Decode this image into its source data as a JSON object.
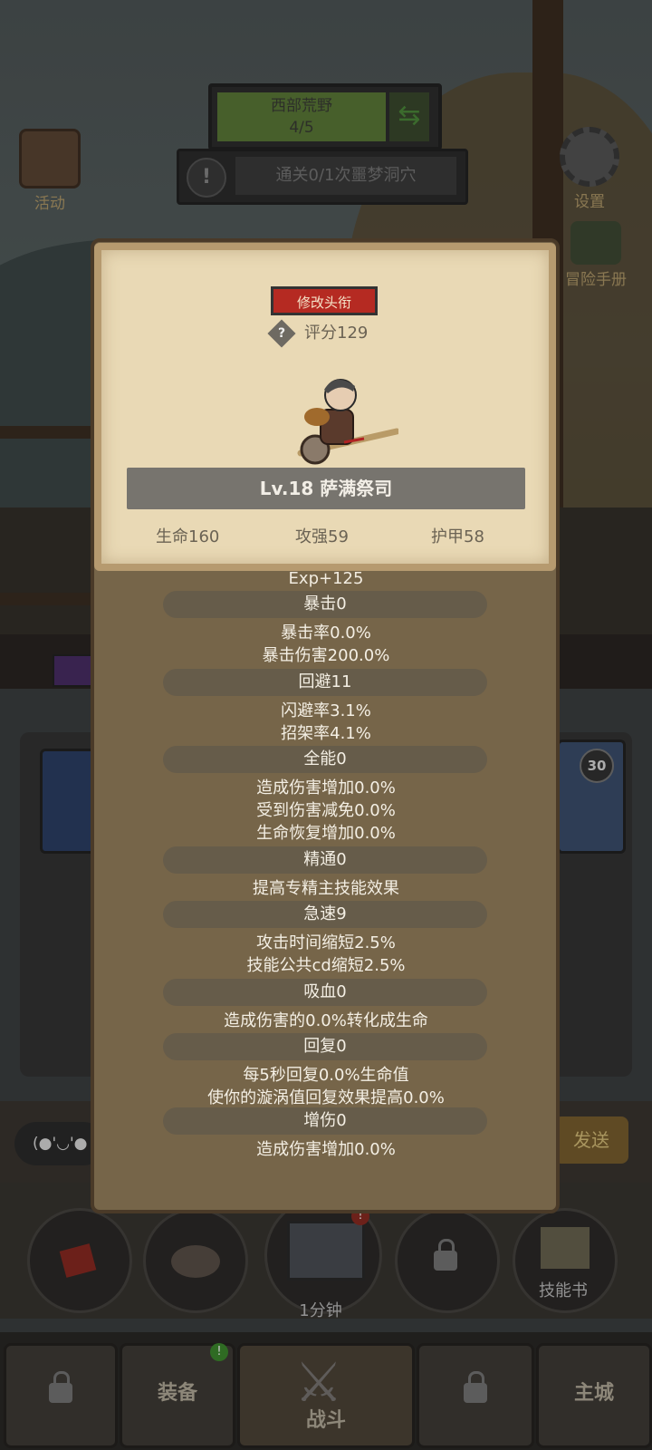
{
  "hud": {
    "zone_name": "西部荒野",
    "zone_progress": "4/5",
    "quest_text": "通关0/1次噩梦洞穴",
    "left_button": "活动",
    "right_button_settings": "设置",
    "right_button_manual": "冒险手册",
    "slot_level": "30"
  },
  "chat": {
    "emote_text": "(●'◡'●",
    "send_label": "发送"
  },
  "skills": {
    "timer_label": "1分钟",
    "skillbook_label": "技能书",
    "badge": "!"
  },
  "nav": {
    "equip_label": "装备",
    "battle_label": "战斗",
    "city_label": "主城",
    "equip_badge": "!"
  },
  "card": {
    "edit_title_button": "修改头衔",
    "score": "评分129",
    "hint_icon": "?",
    "name": "Lv.18 萨满祭司",
    "hp": "生命160",
    "atk": "攻强59",
    "armor": "护甲58",
    "exp": "Exp+125"
  },
  "stats": [
    {
      "head": "暴击0",
      "lines": [
        "暴击率0.0%",
        "暴击伤害200.0%"
      ]
    },
    {
      "head": "回避11",
      "lines": [
        "闪避率3.1%",
        "招架率4.1%"
      ]
    },
    {
      "head": "全能0",
      "lines": [
        "造成伤害增加0.0%",
        "受到伤害减免0.0%",
        "生命恢复增加0.0%"
      ]
    },
    {
      "head": "精通0",
      "lines": [
        "提高专精主技能效果"
      ]
    },
    {
      "head": "急速9",
      "lines": [
        "攻击时间缩短2.5%",
        "技能公共cd缩短2.5%"
      ]
    },
    {
      "head": "吸血0",
      "lines": [
        "造成伤害的0.0%转化成生命"
      ]
    },
    {
      "head": "回复0",
      "lines": [
        "每5秒回复0.0%生命值",
        "使你的漩涡值回复效果提高0.0%"
      ]
    },
    {
      "head": "增伤0",
      "lines": [
        "造成伤害增加0.0%"
      ]
    }
  ]
}
